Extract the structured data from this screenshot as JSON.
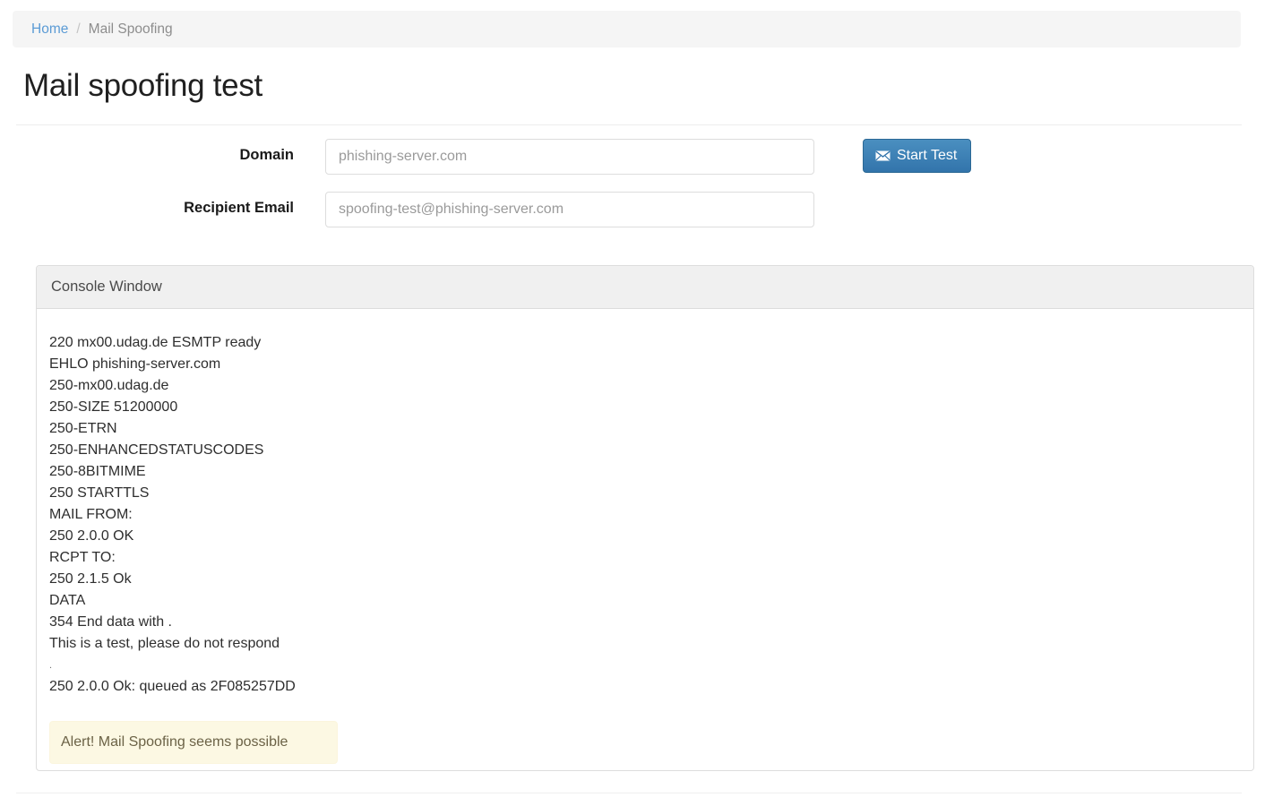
{
  "breadcrumb": {
    "home_label": "Home",
    "separator": "/",
    "current_label": "Mail Spoofing"
  },
  "page_title": "Mail spoofing test",
  "form": {
    "domain": {
      "label": "Domain",
      "value": "phishing-server.com",
      "placeholder": "phishing-server.com"
    },
    "recipient": {
      "label": "Recipient Email",
      "value": "spoofing-test@phishing-server.com",
      "placeholder": "spoofing-test@phishing-server.com"
    },
    "start_button": {
      "label": "Start Test",
      "icon": "envelope-icon"
    }
  },
  "console_panel": {
    "heading": "Console Window",
    "lines": [
      "220 mx00.udag.de ESMTP ready",
      "EHLO phishing-server.com",
      "250-mx00.udag.de",
      "250-SIZE 51200000",
      "250-ETRN",
      "250-ENHANCEDSTATUSCODES",
      "250-8BITMIME",
      "250 STARTTLS",
      "MAIL FROM:",
      "250 2.0.0 OK",
      "RCPT TO:",
      "250 2.1.5 Ok",
      "DATA",
      "354 End data with .",
      "This is a test, please do not respond",
      ".",
      "250 2.0.0 Ok: queued as 2F085257DD"
    ],
    "alert": {
      "text": "Alert! Mail Spoofing seems possible",
      "background": "#fcf8e3",
      "text_color": "#6b6246"
    }
  },
  "colors": {
    "primary_button": "#3274ab",
    "link": "#5b9bd5",
    "breadcrumb_bar": "#f5f5f5",
    "panel_heading": "#f0f0f0",
    "panel_border": "#dddddd"
  }
}
